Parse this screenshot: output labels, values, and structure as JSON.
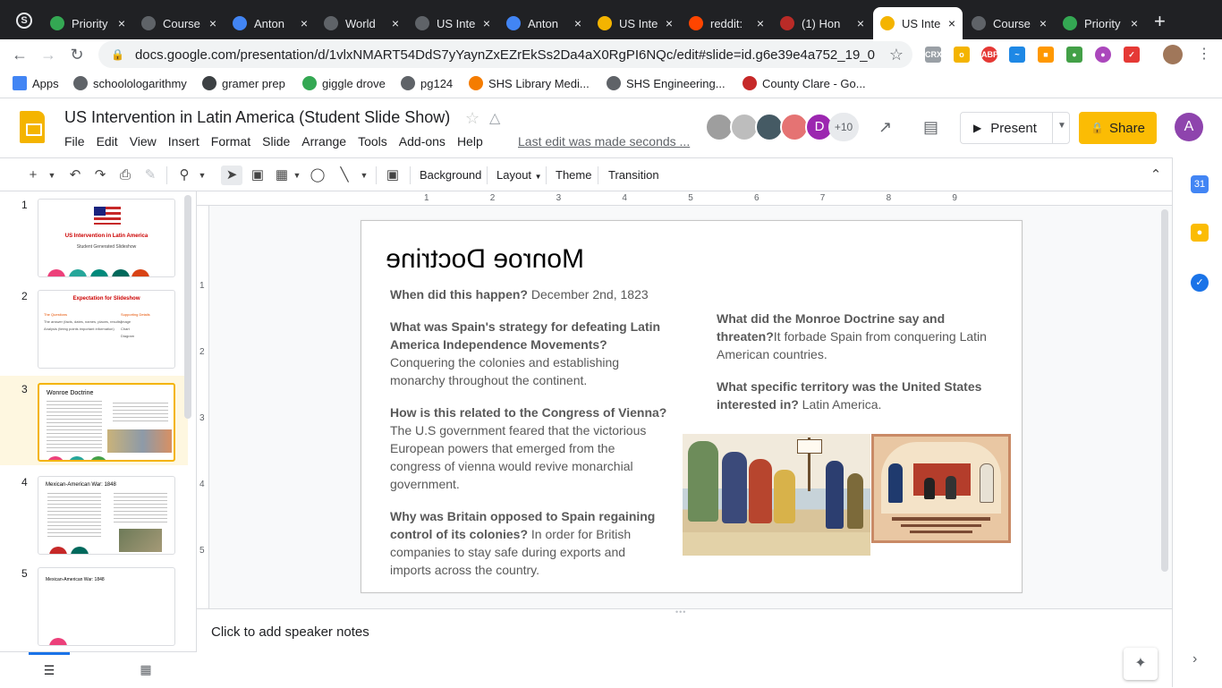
{
  "browser": {
    "tabs": [
      {
        "label": "Priority",
        "icon": "drive-icon",
        "color": "#34a853"
      },
      {
        "label": "Course",
        "icon": "schoology-icon",
        "color": "#5f6368"
      },
      {
        "label": "Anton",
        "icon": "docs-icon",
        "color": "#4285f4"
      },
      {
        "label": "World",
        "icon": "schoology-icon",
        "color": "#5f6368"
      },
      {
        "label": "US Inte",
        "icon": "schoology-icon",
        "color": "#5f6368"
      },
      {
        "label": "Anton",
        "icon": "docs-icon",
        "color": "#4285f4"
      },
      {
        "label": "US Inte",
        "icon": "slides-icon",
        "color": "#f4b400"
      },
      {
        "label": "reddit:",
        "icon": "reddit-icon",
        "color": "#ff4500"
      },
      {
        "label": "(1) Hon",
        "icon": "quora-icon",
        "color": "#b92b27"
      },
      {
        "label": "US Inte",
        "icon": "slides-icon",
        "color": "#f4b400"
      },
      {
        "label": "Course",
        "icon": "schoology-icon",
        "color": "#5f6368"
      },
      {
        "label": "Priority",
        "icon": "drive-icon",
        "color": "#34a853"
      }
    ],
    "url": "docs.google.com/presentation/d/1vlxNMART54DdS7yYaynZxEZrEkSs2Da4aX0RgPI6NQc/edit#slide=id.g6e39e4a752_19_0",
    "bookmarks": [
      {
        "label": "Apps",
        "icon": "apps-grid-icon"
      },
      {
        "label": "schoolologarithmy",
        "icon": "schoology-icon"
      },
      {
        "label": "gramer prep",
        "icon": "bookmark-icon"
      },
      {
        "label": "giggle drove",
        "icon": "drive-icon"
      },
      {
        "label": "pg124",
        "icon": "globe-icon"
      },
      {
        "label": "SHS Library Medi...",
        "icon": "bookmark-icon"
      },
      {
        "label": "SHS Engineering...",
        "icon": "schoology-icon"
      },
      {
        "label": "County Clare - Go...",
        "icon": "image-icon"
      }
    ]
  },
  "doc": {
    "title": "US Intervention in Latin America (Student Slide Show)",
    "menu": [
      "File",
      "Edit",
      "View",
      "Insert",
      "Format",
      "Slide",
      "Arrange",
      "Tools",
      "Add-ons",
      "Help"
    ],
    "last_edit": "Last edit was made seconds ...",
    "collaborator_count": "+10",
    "collaborator_initial": "D",
    "present_label": "Present",
    "share_label": "Share",
    "account_initial": "A"
  },
  "toolbar": {
    "background": "Background",
    "layout": "Layout",
    "theme": "Theme",
    "transition": "Transition"
  },
  "ruler": {
    "h": [
      "1",
      "2",
      "3",
      "4",
      "5",
      "6",
      "7",
      "8",
      "9"
    ],
    "v": [
      "1",
      "2",
      "3",
      "4",
      "5"
    ]
  },
  "filmstrip": [
    {
      "num": "1",
      "title": "US Intervention in Latin America",
      "subtitle": "Student Generated Slideshow"
    },
    {
      "num": "2",
      "title": "Expectation for Slideshow",
      "col1": "The Questions",
      "col2": "Supporting Details",
      "row1a": "The answer (facts, dates, names, places, results)",
      "row1b": "Image",
      "row2a": "Analysis (tieing points important information)",
      "row2b": "Chart",
      "row3b": "Diagram"
    },
    {
      "num": "3",
      "title": "Wonroe Doctrine"
    },
    {
      "num": "4",
      "title": "Mexican-American War: 1848"
    },
    {
      "num": "5",
      "title": "Mexican-American War: 1848"
    }
  ],
  "slide": {
    "title": "Monroe Doctrine",
    "qa": [
      {
        "q": "When did this happen?",
        "a": " December 2nd, 1823"
      },
      {
        "q": "What was Spain's strategy for defeating Latin America Independence Movements?",
        "a": "Conquering the colonies and establishing monarchy throughout the continent."
      },
      {
        "q": "How is this related to the Congress of Vienna?",
        "a": " The U.S government feared that the victorious European powers that emerged from the congress of vienna would revive monarchial government."
      },
      {
        "q": "Why was Britain opposed to Spain regaining control of its colonies?",
        "a": " In order for British companies to stay safe during exports and imports across the country."
      },
      {
        "q": "What did the Monroe Doctrine say and threaten?",
        "a": "It forbade Spain from conquering Latin American countries."
      },
      {
        "q": "What specific territory was the United States interested in?",
        "a": " Latin America."
      }
    ]
  },
  "notes": {
    "placeholder": "Click to add speaker notes"
  }
}
